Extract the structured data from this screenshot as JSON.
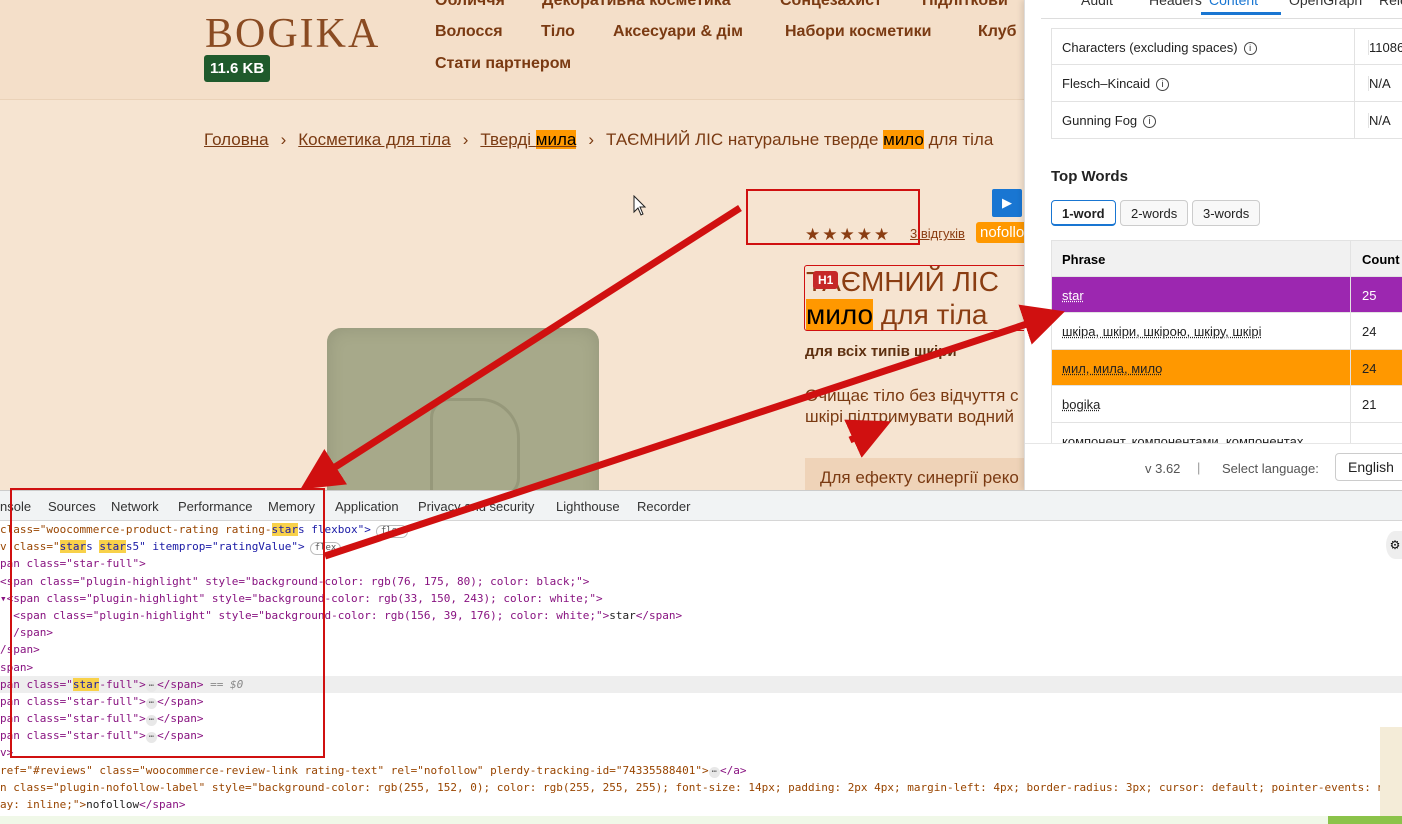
{
  "site": {
    "logo": "BOGIKA",
    "page_size": "11.6 KB",
    "nav_row1": [
      "Обличчя",
      "Декоративна косметика",
      "Сонцезахист",
      "Підліткови"
    ],
    "nav_row2": [
      "Волосся",
      "Тіло",
      "Аксесуари & дім",
      "Набори косметики",
      "Клуб"
    ],
    "nav_row3": [
      "Стати партнером"
    ],
    "breadcrumb": {
      "home": "Головна",
      "body": "Косметика для тіла",
      "solid_a": "Тверді ",
      "solid_b": "мила",
      "current_a": "ТАЄМНИЙ ЛІС натуральне тверде ",
      "current_b": "мило",
      "current_c": " для тіла"
    },
    "stars": "★★★★★",
    "reviews": "3 відгуків",
    "nofollow": "nofollo",
    "play": "▶",
    "h1_badge": "H1",
    "h1_line1": "ТАЄМНИЙ ЛІС",
    "h1_line2_hl": "мило",
    "h1_line2_rest": " для тіла",
    "subtitle": "для всіх типів шкіри",
    "desc_line1": "Очищає тіло без відчуття с",
    "desc_line2": "шкірі підтримувати водний",
    "synergy": "Для ефекту синергії реко"
  },
  "extension": {
    "tabs": [
      "Audit",
      "Headers",
      "Content",
      "OpenGraph",
      "Rele"
    ],
    "active_tab": "Content",
    "stats": [
      {
        "label": "Characters (excluding spaces)",
        "value": "11086"
      },
      {
        "label": "Flesch–Kincaid",
        "value": "N/A"
      },
      {
        "label": "Gunning Fog",
        "value": "N/A"
      }
    ],
    "top_words_title": "Top Words",
    "word_tabs": [
      "1-word",
      "2-words",
      "3-words"
    ],
    "table_header": {
      "phrase": "Phrase",
      "count": "Count"
    },
    "rows": [
      {
        "phrase": "star",
        "count": "25",
        "bg": "#9c27b0",
        "fg": "#ffffff"
      },
      {
        "phrase": "шкіра, шкіри, шкірою, шкіру, шкірі",
        "count": "24",
        "bg": "#ffffff",
        "fg": "#222222"
      },
      {
        "phrase": "мил, мила, мило",
        "count": "24",
        "bg": "#ff9800",
        "fg": "#222222"
      },
      {
        "phrase": "bogika",
        "count": "21",
        "bg": "#ffffff",
        "fg": "#222222"
      },
      {
        "phrase": "компонент, компонентами, компонентах",
        "count": "",
        "bg": "#ffffff",
        "fg": "#222222"
      }
    ],
    "version": "v 3.62",
    "language_label": "Select language:",
    "language": "English"
  },
  "devtools": {
    "tabs": [
      "nsole",
      "Sources",
      "Network",
      "Performance",
      "Memory",
      "Application",
      "Privacy and security",
      "Lighthouse",
      "Recorder"
    ],
    "code": {
      "l1_a": "class=\"woocommerce-product-rating rating-",
      "l1_hl": "star",
      "l1_b": "s flexbox\">",
      "flex": "flex",
      "l2_a": "v class=\"",
      "l2_hl1": "star",
      "l2_mid": "s ",
      "l2_hl2": "star",
      "l2_b": "s5\" itemprop=\"ratingValue\">",
      "l3": "pan class=\"star-full\">",
      "l4": "<span class=\"plugin-highlight\" style=\"background-color: rgb(76, 175, 80); color: black;\">",
      "l5": "<span class=\"plugin-highlight\" style=\"background-color: rgb(33, 150, 243); color: white;\">",
      "l6_a": "<span class=\"plugin-highlight\" style=\"background-color: rgb(156, 39, 176); color: white;\">",
      "l6_text": "star",
      "l6_b": "</span>",
      "l7": "/span>",
      "l8": "/span>",
      "l9": "span>",
      "l10_a": "pan class=\"",
      "l10_hl": "star",
      "l10_b": "-full\">",
      "l10_close": "</span>",
      "l10_eq": " == $0",
      "l11": "pan class=\"star-full\">",
      "l12": "pan class=\"star-full\">",
      "l13": "pan class=\"star-full\">",
      "ell": "⋯",
      "close": "</span>",
      "l14": "v>",
      "l15": "ref=\"#reviews\" class=\"woocommerce-review-link rating-text\" rel=\"nofollow\" plerdy-tracking-id=\"74335588401\">",
      "l15_close": "</a>",
      "l16": "n class=\"plugin-nofollow-label\" style=\"background-color: rgb(255, 152, 0); color: rgb(255, 255, 255); font-size: 14px; padding: 2px 4px; margin-left: 4px; border-radius: 3px; cursor: default; pointer-events: no",
      "l17_a": "ay: inline;\">",
      "l17_text": "nofollow",
      "l17_b": "</span>"
    }
  },
  "colors": {
    "annotation_red": "#d01010",
    "highlight_orange": "#ff9800",
    "highlight_purple": "#9c27b0",
    "brand_brown": "#7a3a12"
  }
}
